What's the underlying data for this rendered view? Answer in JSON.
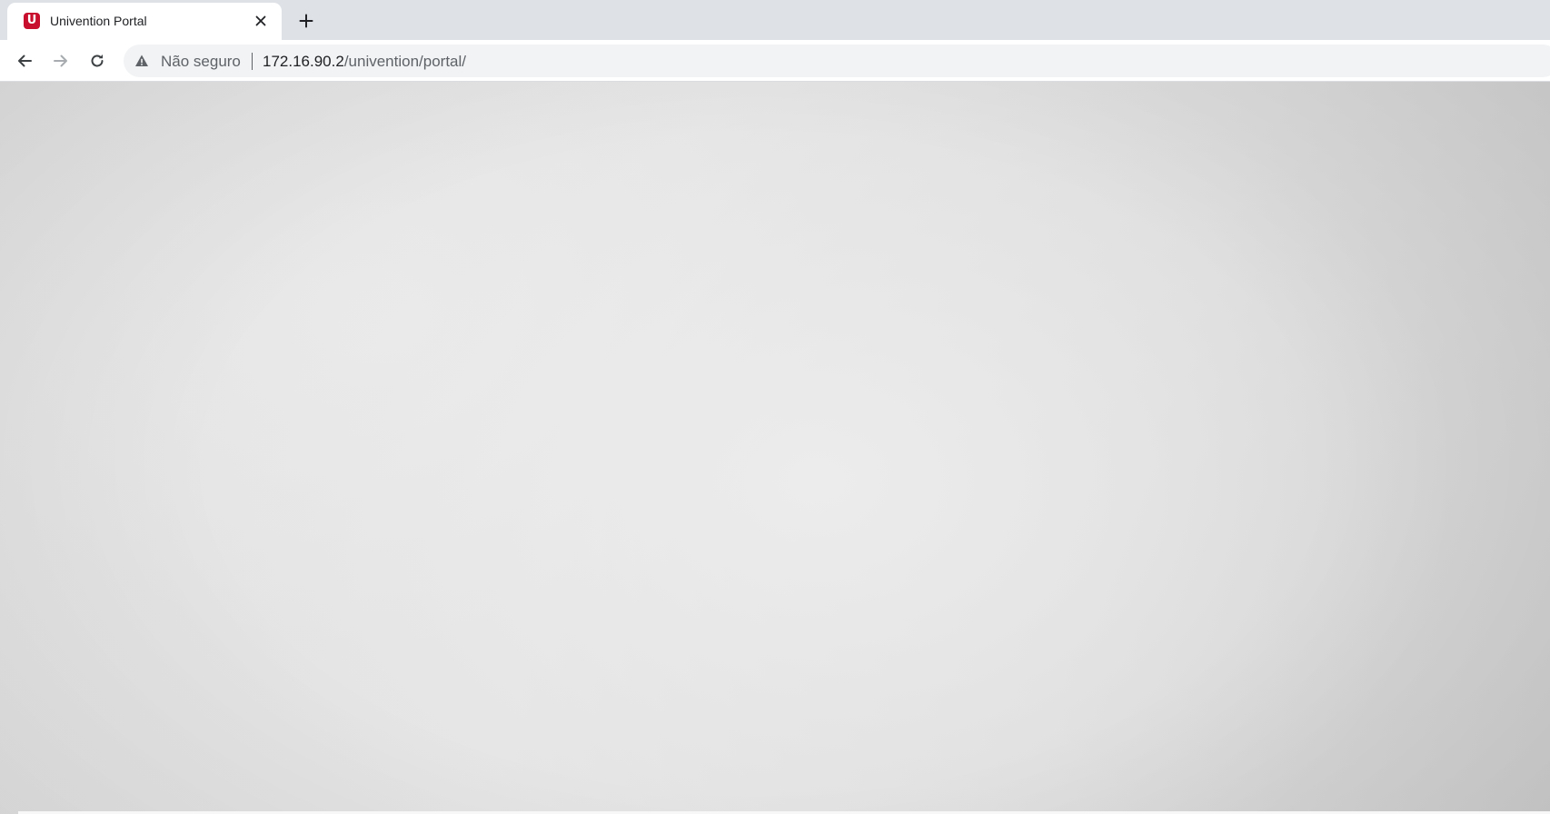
{
  "browser": {
    "tab": {
      "title": "Univention Portal",
      "favicon_letter": "U",
      "favicon_color": "#c8102e",
      "favicon_icon": "univention-logo-icon",
      "close_icon": "close-icon"
    },
    "new_tab_icon": "plus-icon",
    "toolbar": {
      "back_icon": "arrow-left-icon",
      "forward_icon": "arrow-right-icon",
      "reload_icon": "reload-icon"
    },
    "address_bar": {
      "security_icon": "warning-icon",
      "security_label": "Não seguro",
      "url_host": "172.16.90.2",
      "url_path": "/univention/portal/"
    }
  },
  "colors": {
    "tab_strip": "#dee1e6",
    "omnibox": "#f1f3f4",
    "page_background": "#e2e2e2",
    "text_primary": "#202124",
    "text_secondary": "#5f6368"
  }
}
